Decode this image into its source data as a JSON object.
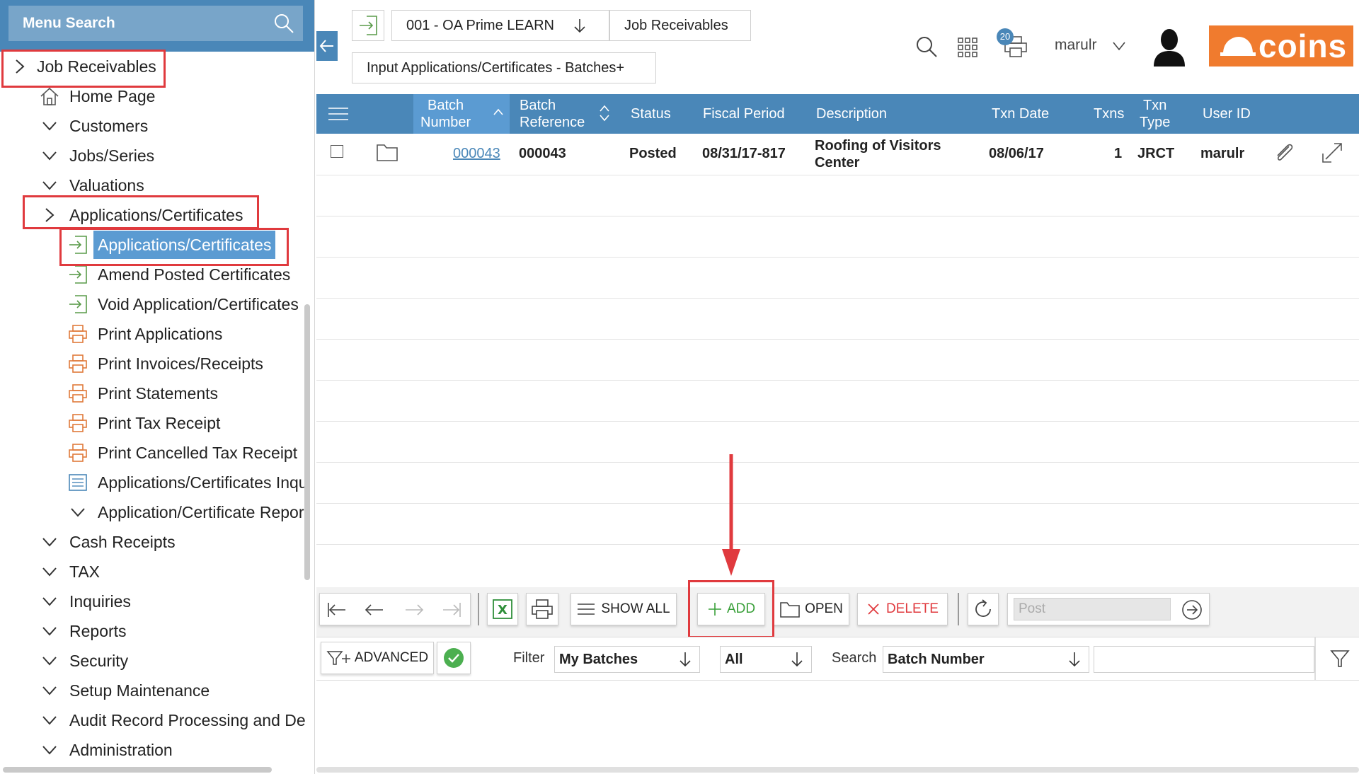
{
  "sidebar": {
    "search_label": "Menu Search",
    "tree": {
      "root": "Job Receivables",
      "home": "Home Page",
      "customers": "Customers",
      "jobs_series": "Jobs/Series",
      "valuations": "Valuations",
      "app_cert_group": "Applications/Certificates",
      "app_cert_item": "Applications/Certificates",
      "amend_posted": "Amend Posted Certificates",
      "void_app": "Void Application/Certificates",
      "print_apps": "Print Applications",
      "print_invoices": "Print Invoices/Receipts",
      "print_statements": "Print Statements",
      "print_tax": "Print Tax Receipt",
      "print_cancelled_tax": "Print Cancelled Tax Receipt",
      "app_cert_inquiry": "Applications/Certificates Inqu",
      "app_cert_report": "Application/Certificate Repor",
      "cash_receipts": "Cash Receipts",
      "tax": "TAX",
      "inquiries": "Inquiries",
      "reports": "Reports",
      "security": "Security",
      "setup_maintenance": "Setup Maintenance",
      "audit_record": "Audit Record Processing and Dele",
      "administration": "Administration"
    }
  },
  "header": {
    "company": "001 - OA Prime LEARN",
    "module": "Job Receivables",
    "page": "Input Applications/Certificates - Batches+",
    "print_badge": "20",
    "user": "marulr",
    "logo_text": "coins"
  },
  "grid": {
    "columns": {
      "batch_number": [
        "Batch",
        "Number"
      ],
      "batch_reference": [
        "Batch",
        "Reference"
      ],
      "status": "Status",
      "fiscal_period": "Fiscal Period",
      "description": "Description",
      "txn_date": "Txn Date",
      "txns": "Txns",
      "txn_type": [
        "Txn",
        "Type"
      ],
      "user_id": "User ID"
    },
    "rows": [
      {
        "batch_number": "000043",
        "batch_reference": "000043",
        "status": "Posted",
        "fiscal_period": "08/31/17-817",
        "description": [
          "Roofing of Visitors",
          "Center"
        ],
        "txn_date": "08/06/17",
        "txns": "1",
        "txn_type": "JRCT",
        "user_id": "marulr"
      }
    ]
  },
  "toolbar": {
    "show_all": "SHOW ALL",
    "add": "ADD",
    "open": "OPEN",
    "delete": "DELETE",
    "post_placeholder": "Post"
  },
  "filter": {
    "advanced": "ADVANCED",
    "filter_label": "Filter",
    "filter_value": "My Batches",
    "scope_value": "All",
    "search_label": "Search",
    "search_field": "Batch Number",
    "search_value": ""
  },
  "colors": {
    "accent": "#4a87b8",
    "selected": "#5b9bd2",
    "brand": "#f07b2e",
    "annotation": "#e03a3e",
    "delete": "#e03a3e",
    "add": "#3aa03a"
  }
}
